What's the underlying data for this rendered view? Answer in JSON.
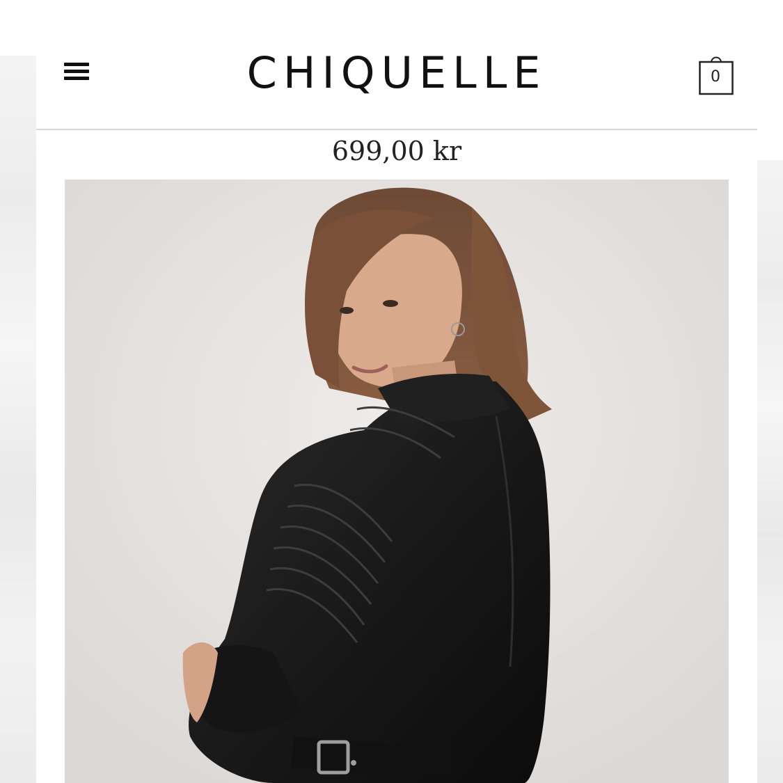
{
  "header": {
    "brand": "CHIQUELLE",
    "menu_icon": "hamburger-menu-icon",
    "cart_icon": "shopping-bag-icon",
    "cart_count": "0"
  },
  "product": {
    "price": "699,00 kr",
    "image_subject": "woman-in-black-leather-biker-jacket"
  },
  "colors": {
    "text": "#111111",
    "divider": "#d9d9d9",
    "image_background": "#e8e5e3"
  }
}
